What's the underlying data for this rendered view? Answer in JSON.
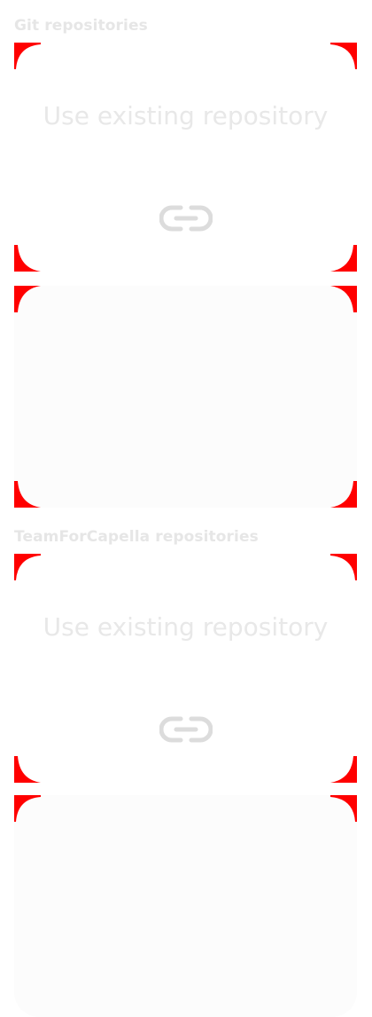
{
  "sections": [
    {
      "title": "Git repositories",
      "cards": [
        {
          "label": "Use existing repository",
          "icon": "link-icon"
        },
        {
          "label": "",
          "icon": ""
        }
      ]
    },
    {
      "title": "TeamForCapella repositories",
      "cards": [
        {
          "label": "Use existing repository",
          "icon": "link-icon"
        },
        {
          "label": "",
          "icon": ""
        }
      ]
    }
  ],
  "colors": {
    "corner_marker": "#ff0000",
    "title_text": "#e6e6e6",
    "card_text": "#e8e8e8",
    "icon": "#dcdcdc"
  }
}
